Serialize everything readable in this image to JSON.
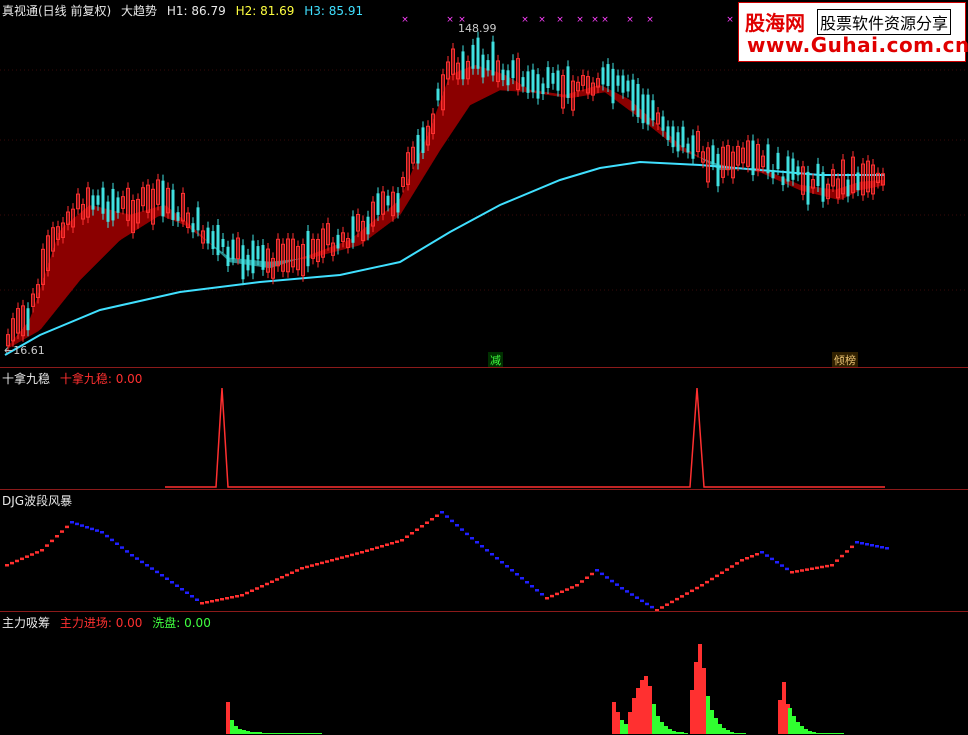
{
  "panel1": {
    "title": "真视通(日线 前复权)",
    "indicator": "大趋势",
    "h1_label": "H1: 86.79",
    "h2_label": "H2: 81.69",
    "h3_label": "H3: 85.91",
    "high_price": "148.99",
    "low_price": "16.61",
    "signal_1": "减",
    "signal_2": "倾榜"
  },
  "panel2": {
    "title": "十拿九稳",
    "value_label": "十拿九稳: 0.00"
  },
  "panel3": {
    "title": "DJG波段风暴"
  },
  "panel4": {
    "title": "主力吸筹",
    "in_label": "主力进场: 0.00",
    "out_label": "洗盘: 0.00"
  },
  "logo": {
    "brand": "股海网",
    "tagline": "股票软件资源分享",
    "url": "www.Guhai.com.cn"
  },
  "colors": {
    "up": "#ff3030",
    "down": "#40e0e0",
    "ma_cyan": "#40e0ff",
    "fill_red": "#8b0000",
    "fill_teal": "#2a8c8c",
    "border": "#8b1a1a",
    "magenta": "#ff40ff",
    "blue": "#2020ff",
    "green": "#30ff30"
  }
}
